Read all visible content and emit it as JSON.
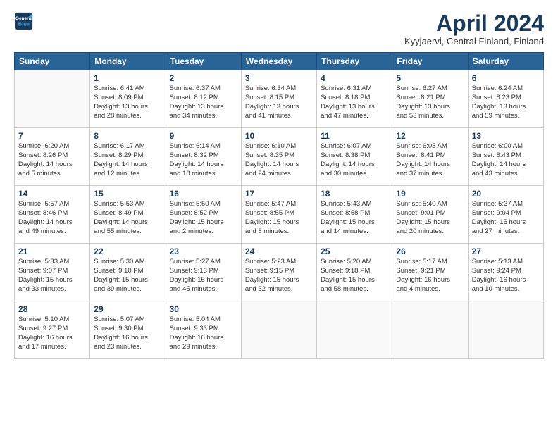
{
  "header": {
    "logo_line1": "General",
    "logo_line2": "Blue",
    "month_title": "April 2024",
    "location": "Kyyjaervi, Central Finland, Finland"
  },
  "days_of_week": [
    "Sunday",
    "Monday",
    "Tuesday",
    "Wednesday",
    "Thursday",
    "Friday",
    "Saturday"
  ],
  "weeks": [
    [
      {
        "day": "",
        "info": ""
      },
      {
        "day": "1",
        "info": "Sunrise: 6:41 AM\nSunset: 8:09 PM\nDaylight: 13 hours\nand 28 minutes."
      },
      {
        "day": "2",
        "info": "Sunrise: 6:37 AM\nSunset: 8:12 PM\nDaylight: 13 hours\nand 34 minutes."
      },
      {
        "day": "3",
        "info": "Sunrise: 6:34 AM\nSunset: 8:15 PM\nDaylight: 13 hours\nand 41 minutes."
      },
      {
        "day": "4",
        "info": "Sunrise: 6:31 AM\nSunset: 8:18 PM\nDaylight: 13 hours\nand 47 minutes."
      },
      {
        "day": "5",
        "info": "Sunrise: 6:27 AM\nSunset: 8:21 PM\nDaylight: 13 hours\nand 53 minutes."
      },
      {
        "day": "6",
        "info": "Sunrise: 6:24 AM\nSunset: 8:23 PM\nDaylight: 13 hours\nand 59 minutes."
      }
    ],
    [
      {
        "day": "7",
        "info": "Sunrise: 6:20 AM\nSunset: 8:26 PM\nDaylight: 14 hours\nand 5 minutes."
      },
      {
        "day": "8",
        "info": "Sunrise: 6:17 AM\nSunset: 8:29 PM\nDaylight: 14 hours\nand 12 minutes."
      },
      {
        "day": "9",
        "info": "Sunrise: 6:14 AM\nSunset: 8:32 PM\nDaylight: 14 hours\nand 18 minutes."
      },
      {
        "day": "10",
        "info": "Sunrise: 6:10 AM\nSunset: 8:35 PM\nDaylight: 14 hours\nand 24 minutes."
      },
      {
        "day": "11",
        "info": "Sunrise: 6:07 AM\nSunset: 8:38 PM\nDaylight: 14 hours\nand 30 minutes."
      },
      {
        "day": "12",
        "info": "Sunrise: 6:03 AM\nSunset: 8:41 PM\nDaylight: 14 hours\nand 37 minutes."
      },
      {
        "day": "13",
        "info": "Sunrise: 6:00 AM\nSunset: 8:43 PM\nDaylight: 14 hours\nand 43 minutes."
      }
    ],
    [
      {
        "day": "14",
        "info": "Sunrise: 5:57 AM\nSunset: 8:46 PM\nDaylight: 14 hours\nand 49 minutes."
      },
      {
        "day": "15",
        "info": "Sunrise: 5:53 AM\nSunset: 8:49 PM\nDaylight: 14 hours\nand 55 minutes."
      },
      {
        "day": "16",
        "info": "Sunrise: 5:50 AM\nSunset: 8:52 PM\nDaylight: 15 hours\nand 2 minutes."
      },
      {
        "day": "17",
        "info": "Sunrise: 5:47 AM\nSunset: 8:55 PM\nDaylight: 15 hours\nand 8 minutes."
      },
      {
        "day": "18",
        "info": "Sunrise: 5:43 AM\nSunset: 8:58 PM\nDaylight: 15 hours\nand 14 minutes."
      },
      {
        "day": "19",
        "info": "Sunrise: 5:40 AM\nSunset: 9:01 PM\nDaylight: 15 hours\nand 20 minutes."
      },
      {
        "day": "20",
        "info": "Sunrise: 5:37 AM\nSunset: 9:04 PM\nDaylight: 15 hours\nand 27 minutes."
      }
    ],
    [
      {
        "day": "21",
        "info": "Sunrise: 5:33 AM\nSunset: 9:07 PM\nDaylight: 15 hours\nand 33 minutes."
      },
      {
        "day": "22",
        "info": "Sunrise: 5:30 AM\nSunset: 9:10 PM\nDaylight: 15 hours\nand 39 minutes."
      },
      {
        "day": "23",
        "info": "Sunrise: 5:27 AM\nSunset: 9:13 PM\nDaylight: 15 hours\nand 45 minutes."
      },
      {
        "day": "24",
        "info": "Sunrise: 5:23 AM\nSunset: 9:15 PM\nDaylight: 15 hours\nand 52 minutes."
      },
      {
        "day": "25",
        "info": "Sunrise: 5:20 AM\nSunset: 9:18 PM\nDaylight: 15 hours\nand 58 minutes."
      },
      {
        "day": "26",
        "info": "Sunrise: 5:17 AM\nSunset: 9:21 PM\nDaylight: 16 hours\nand 4 minutes."
      },
      {
        "day": "27",
        "info": "Sunrise: 5:13 AM\nSunset: 9:24 PM\nDaylight: 16 hours\nand 10 minutes."
      }
    ],
    [
      {
        "day": "28",
        "info": "Sunrise: 5:10 AM\nSunset: 9:27 PM\nDaylight: 16 hours\nand 17 minutes."
      },
      {
        "day": "29",
        "info": "Sunrise: 5:07 AM\nSunset: 9:30 PM\nDaylight: 16 hours\nand 23 minutes."
      },
      {
        "day": "30",
        "info": "Sunrise: 5:04 AM\nSunset: 9:33 PM\nDaylight: 16 hours\nand 29 minutes."
      },
      {
        "day": "",
        "info": ""
      },
      {
        "day": "",
        "info": ""
      },
      {
        "day": "",
        "info": ""
      },
      {
        "day": "",
        "info": ""
      }
    ]
  ]
}
